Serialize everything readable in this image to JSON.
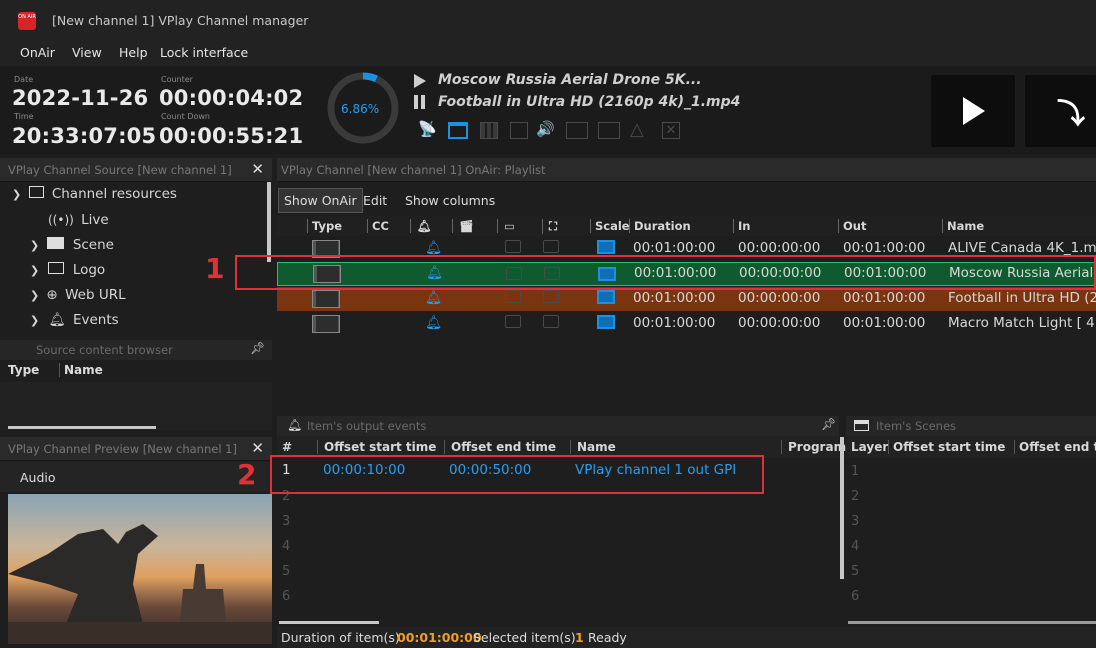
{
  "window": {
    "title": "[New channel 1] VPlay Channel manager",
    "app_badge": "ON AIR"
  },
  "menu": {
    "items": [
      "OnAir",
      "View",
      "Help",
      "Lock interface"
    ]
  },
  "header": {
    "date_label": "Date",
    "date_value": "2022-11-26",
    "time_label": "Time",
    "time_value": "20:33:07:05",
    "counter_label": "Counter",
    "counter_value": "00:00:04:02",
    "countdown_label": "Count Down",
    "countdown_value": "00:00:55:21",
    "progress_text": "6.86%",
    "progress_fraction": 0.0686,
    "now_playing": "Moscow Russia Aerial Drone 5K...",
    "next_item": "Football in Ultra HD (2160p 4k)_1.mp4"
  },
  "source_panel": {
    "title": "VPlay Channel Source [New channel 1]",
    "tree": [
      "Channel resources",
      "Live",
      "Scene",
      "Logo",
      "Web URL",
      "Events"
    ],
    "browser_title": "Source content browser",
    "browser_cols": [
      "Type",
      "Name"
    ]
  },
  "preview_panel": {
    "title": "VPlay Channel Preview [New channel 1]",
    "audio_label": "Audio"
  },
  "playlist": {
    "title": "VPlay Channel [New channel 1] OnAir: Playlist",
    "tabs": [
      "Show OnAir",
      "Edit",
      "Show columns"
    ],
    "columns": [
      "Type",
      "CC",
      "Scale",
      "Duration",
      "In",
      "Out",
      "Name"
    ],
    "rows": [
      {
        "duration": "00:01:00:00",
        "in": "00:00:00:00",
        "out": "00:01:00:00",
        "name": "ALIVE  Canada 4K_1.m",
        "state": "normal"
      },
      {
        "duration": "00:01:00:00",
        "in": "00:00:00:00",
        "out": "00:01:00:00",
        "name": "Moscow Russia Aerial",
        "state": "onair"
      },
      {
        "duration": "00:01:00:00",
        "in": "00:00:00:00",
        "out": "00:01:00:00",
        "name": "Football in Ultra HD (2",
        "state": "next"
      },
      {
        "duration": "00:01:00:00",
        "in": "00:00:00:00",
        "out": "00:01:00:00",
        "name": "Macro Match Light [ 4",
        "state": "normal"
      }
    ]
  },
  "events_panel": {
    "title": "Item's output events",
    "columns": [
      "#",
      "Offset start time",
      "Offset end time",
      "Name",
      "Program"
    ],
    "rows": [
      {
        "num": "1",
        "start": "00:00:10:00",
        "end": "00:00:50:00",
        "name": "VPlay channel 1 out GPI"
      }
    ],
    "row_numbers": [
      "2",
      "3",
      "4",
      "5",
      "6"
    ]
  },
  "scenes_panel": {
    "title": "Item's Scenes",
    "columns": [
      "Layer",
      "Offset start time",
      "Offset end ti"
    ],
    "row_numbers": [
      "1",
      "2",
      "3",
      "4",
      "5",
      "6"
    ]
  },
  "status": {
    "duration_label": "Duration of item(s)",
    "duration_value": "00:01:00:00",
    "selected_label": "Selected item(s)",
    "selected_value": "1",
    "state": "Ready"
  },
  "annotations": {
    "callout_1": "1",
    "callout_2": "2"
  },
  "colors": {
    "accent": "#1e90e0",
    "onair_row": "#0f5a2f",
    "next_row": "#7a3410",
    "callout": "#e0303a",
    "status_value": "#f0a020"
  }
}
